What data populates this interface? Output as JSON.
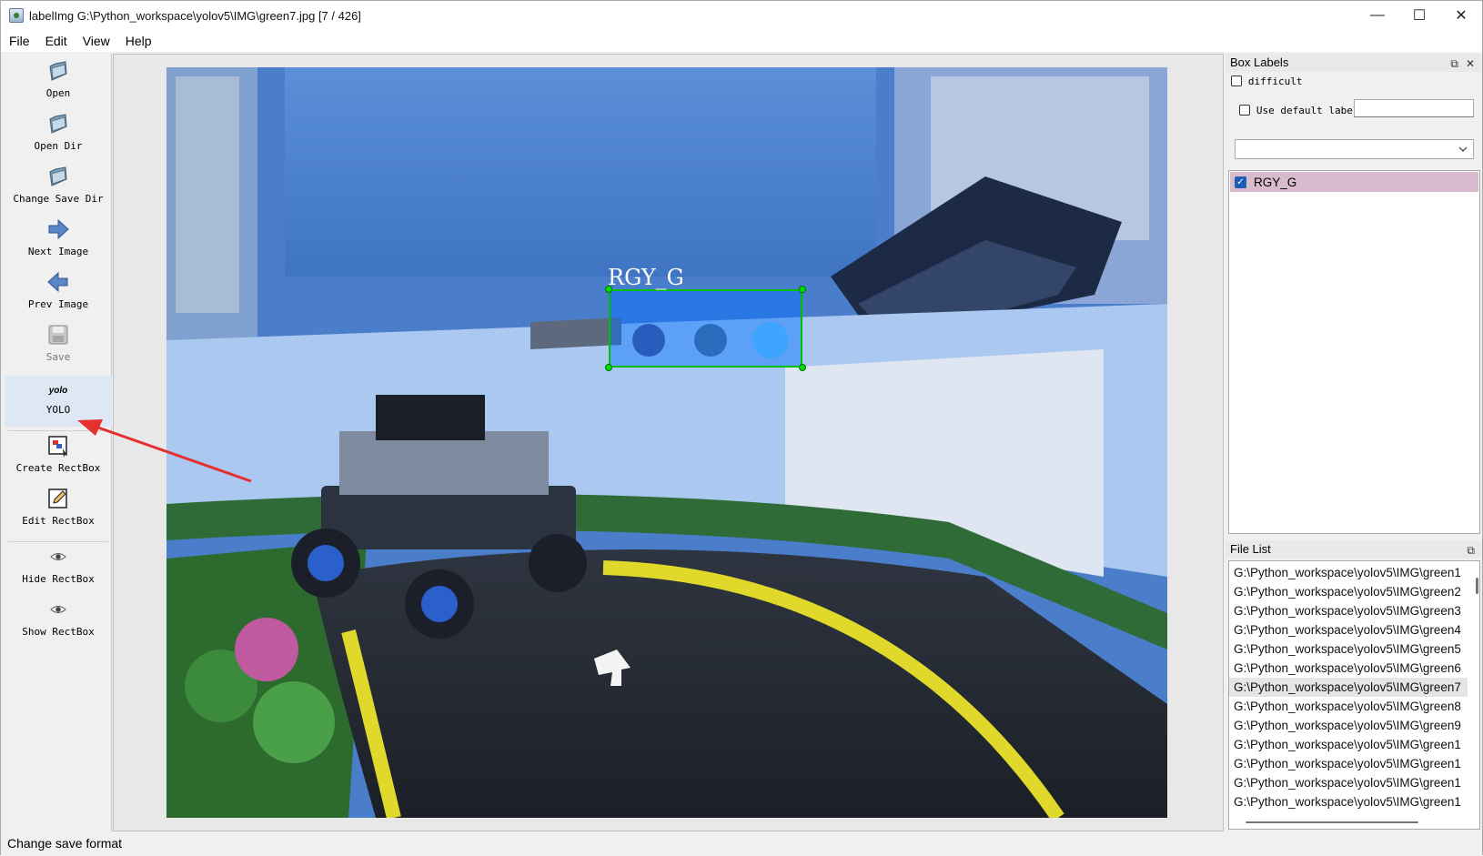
{
  "window": {
    "title": "labelImg G:\\Python_workspace\\yolov5\\IMG\\green7.jpg [7 / 426]",
    "controls": {
      "minimize": "—",
      "maximize": "☐",
      "close": "✕"
    }
  },
  "menu": [
    "File",
    "Edit",
    "View",
    "Help"
  ],
  "toolbar": {
    "open": "Open",
    "open_dir": "Open Dir",
    "change_save_dir": "Change Save Dir",
    "next_image": "Next Image",
    "prev_image": "Prev Image",
    "save": "Save",
    "format_icon_text": "yolo",
    "format": "YOLO",
    "create_rectbox": "Create RectBox",
    "edit_rectbox": "Edit RectBox",
    "hide_rectbox": "Hide RectBox",
    "show_rectbox": "Show RectBox"
  },
  "canvas": {
    "annotation_label": "RGY_G"
  },
  "box_labels": {
    "title": "Box Labels",
    "difficult": "difficult",
    "difficult_checked": false,
    "use_default_label": "Use default label",
    "use_default_checked": false,
    "default_label_value": "",
    "combo_value": "",
    "labels": [
      {
        "text": "RGY_G",
        "checked": true
      }
    ]
  },
  "file_list": {
    "title": "File List",
    "files": [
      "G:\\Python_workspace\\yolov5\\IMG\\green1",
      "G:\\Python_workspace\\yolov5\\IMG\\green2",
      "G:\\Python_workspace\\yolov5\\IMG\\green3",
      "G:\\Python_workspace\\yolov5\\IMG\\green4",
      "G:\\Python_workspace\\yolov5\\IMG\\green5",
      "G:\\Python_workspace\\yolov5\\IMG\\green6",
      "G:\\Python_workspace\\yolov5\\IMG\\green7",
      "G:\\Python_workspace\\yolov5\\IMG\\green8",
      "G:\\Python_workspace\\yolov5\\IMG\\green9",
      "G:\\Python_workspace\\yolov5\\IMG\\green1",
      "G:\\Python_workspace\\yolov5\\IMG\\green1",
      "G:\\Python_workspace\\yolov5\\IMG\\green1",
      "G:\\Python_workspace\\yolov5\\IMG\\green1"
    ],
    "selected_index": 6
  },
  "status": {
    "text": "Change save format"
  },
  "colors": {
    "annotation_arrow": "#e53030",
    "bbox_border": "#00c000",
    "bbox_fill": "#006eff",
    "selected_label_bg": "#d6bccd"
  }
}
